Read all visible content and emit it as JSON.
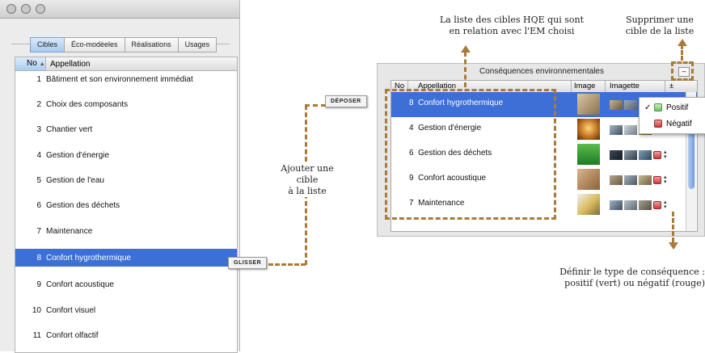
{
  "left_window": {
    "tabs": [
      "Cibles",
      "Éco-modèeles",
      "Réalisations",
      "Usages"
    ],
    "active_tab": "Cibles",
    "columns": {
      "no": "No",
      "appellation": "Appellation",
      "sort_indicator": "▲"
    },
    "rows": [
      {
        "no": "1",
        "label": "Bâtiment et son environnement immédiat"
      },
      {
        "no": "2",
        "label": "Choix des composants"
      },
      {
        "no": "3",
        "label": "Chantier vert"
      },
      {
        "no": "4",
        "label": "Gestion d'énergie"
      },
      {
        "no": "5",
        "label": "Gestion de l'eau"
      },
      {
        "no": "6",
        "label": "Gestion des déchets"
      },
      {
        "no": "7",
        "label": "Maintenance"
      },
      {
        "no": "8",
        "label": "Confort hygrothermique",
        "selected": true
      },
      {
        "no": "9",
        "label": "Confort acoustique"
      },
      {
        "no": "10",
        "label": "Confort visuel"
      },
      {
        "no": "11",
        "label": "Confort olfactif"
      }
    ]
  },
  "right_window": {
    "title": "Conséquences environnementales",
    "remove_button": "–",
    "columns": {
      "no": "No",
      "appellation": "Appellation",
      "image": "Image",
      "imagette": "Imagette",
      "sign": "±"
    },
    "rows": [
      {
        "no": "8",
        "label": "Confort hygrothermique",
        "selected": true
      },
      {
        "no": "4",
        "label": "Gestion d'énergie"
      },
      {
        "no": "6",
        "label": "Gestion des déchets"
      },
      {
        "no": "9",
        "label": "Confort acoustique"
      },
      {
        "no": "7",
        "label": "Maintenance"
      }
    ],
    "popup": {
      "checkmark": "✓",
      "options": [
        "Positif",
        "Négatif"
      ],
      "selected": "Positif"
    }
  },
  "drag_tags": {
    "glisser": "GLISSER",
    "deposer": "DÉPOSER"
  },
  "annotations": {
    "top_list": [
      "La liste des cibles HQE qui sont",
      "en relation avec l'EM choisi"
    ],
    "remove": [
      "Supprimer une",
      "cible de la liste"
    ],
    "add": [
      "Ajouter une",
      "cible",
      "à la liste"
    ],
    "define": [
      "Définir le type de conséquence :",
      "positif (vert) ou négatif (rouge)"
    ]
  },
  "colors": {
    "selection": "#3d6fd6",
    "annotation_dash": "#a77b3a",
    "positive": "#6cc35e",
    "negative": "#d13a3a"
  }
}
